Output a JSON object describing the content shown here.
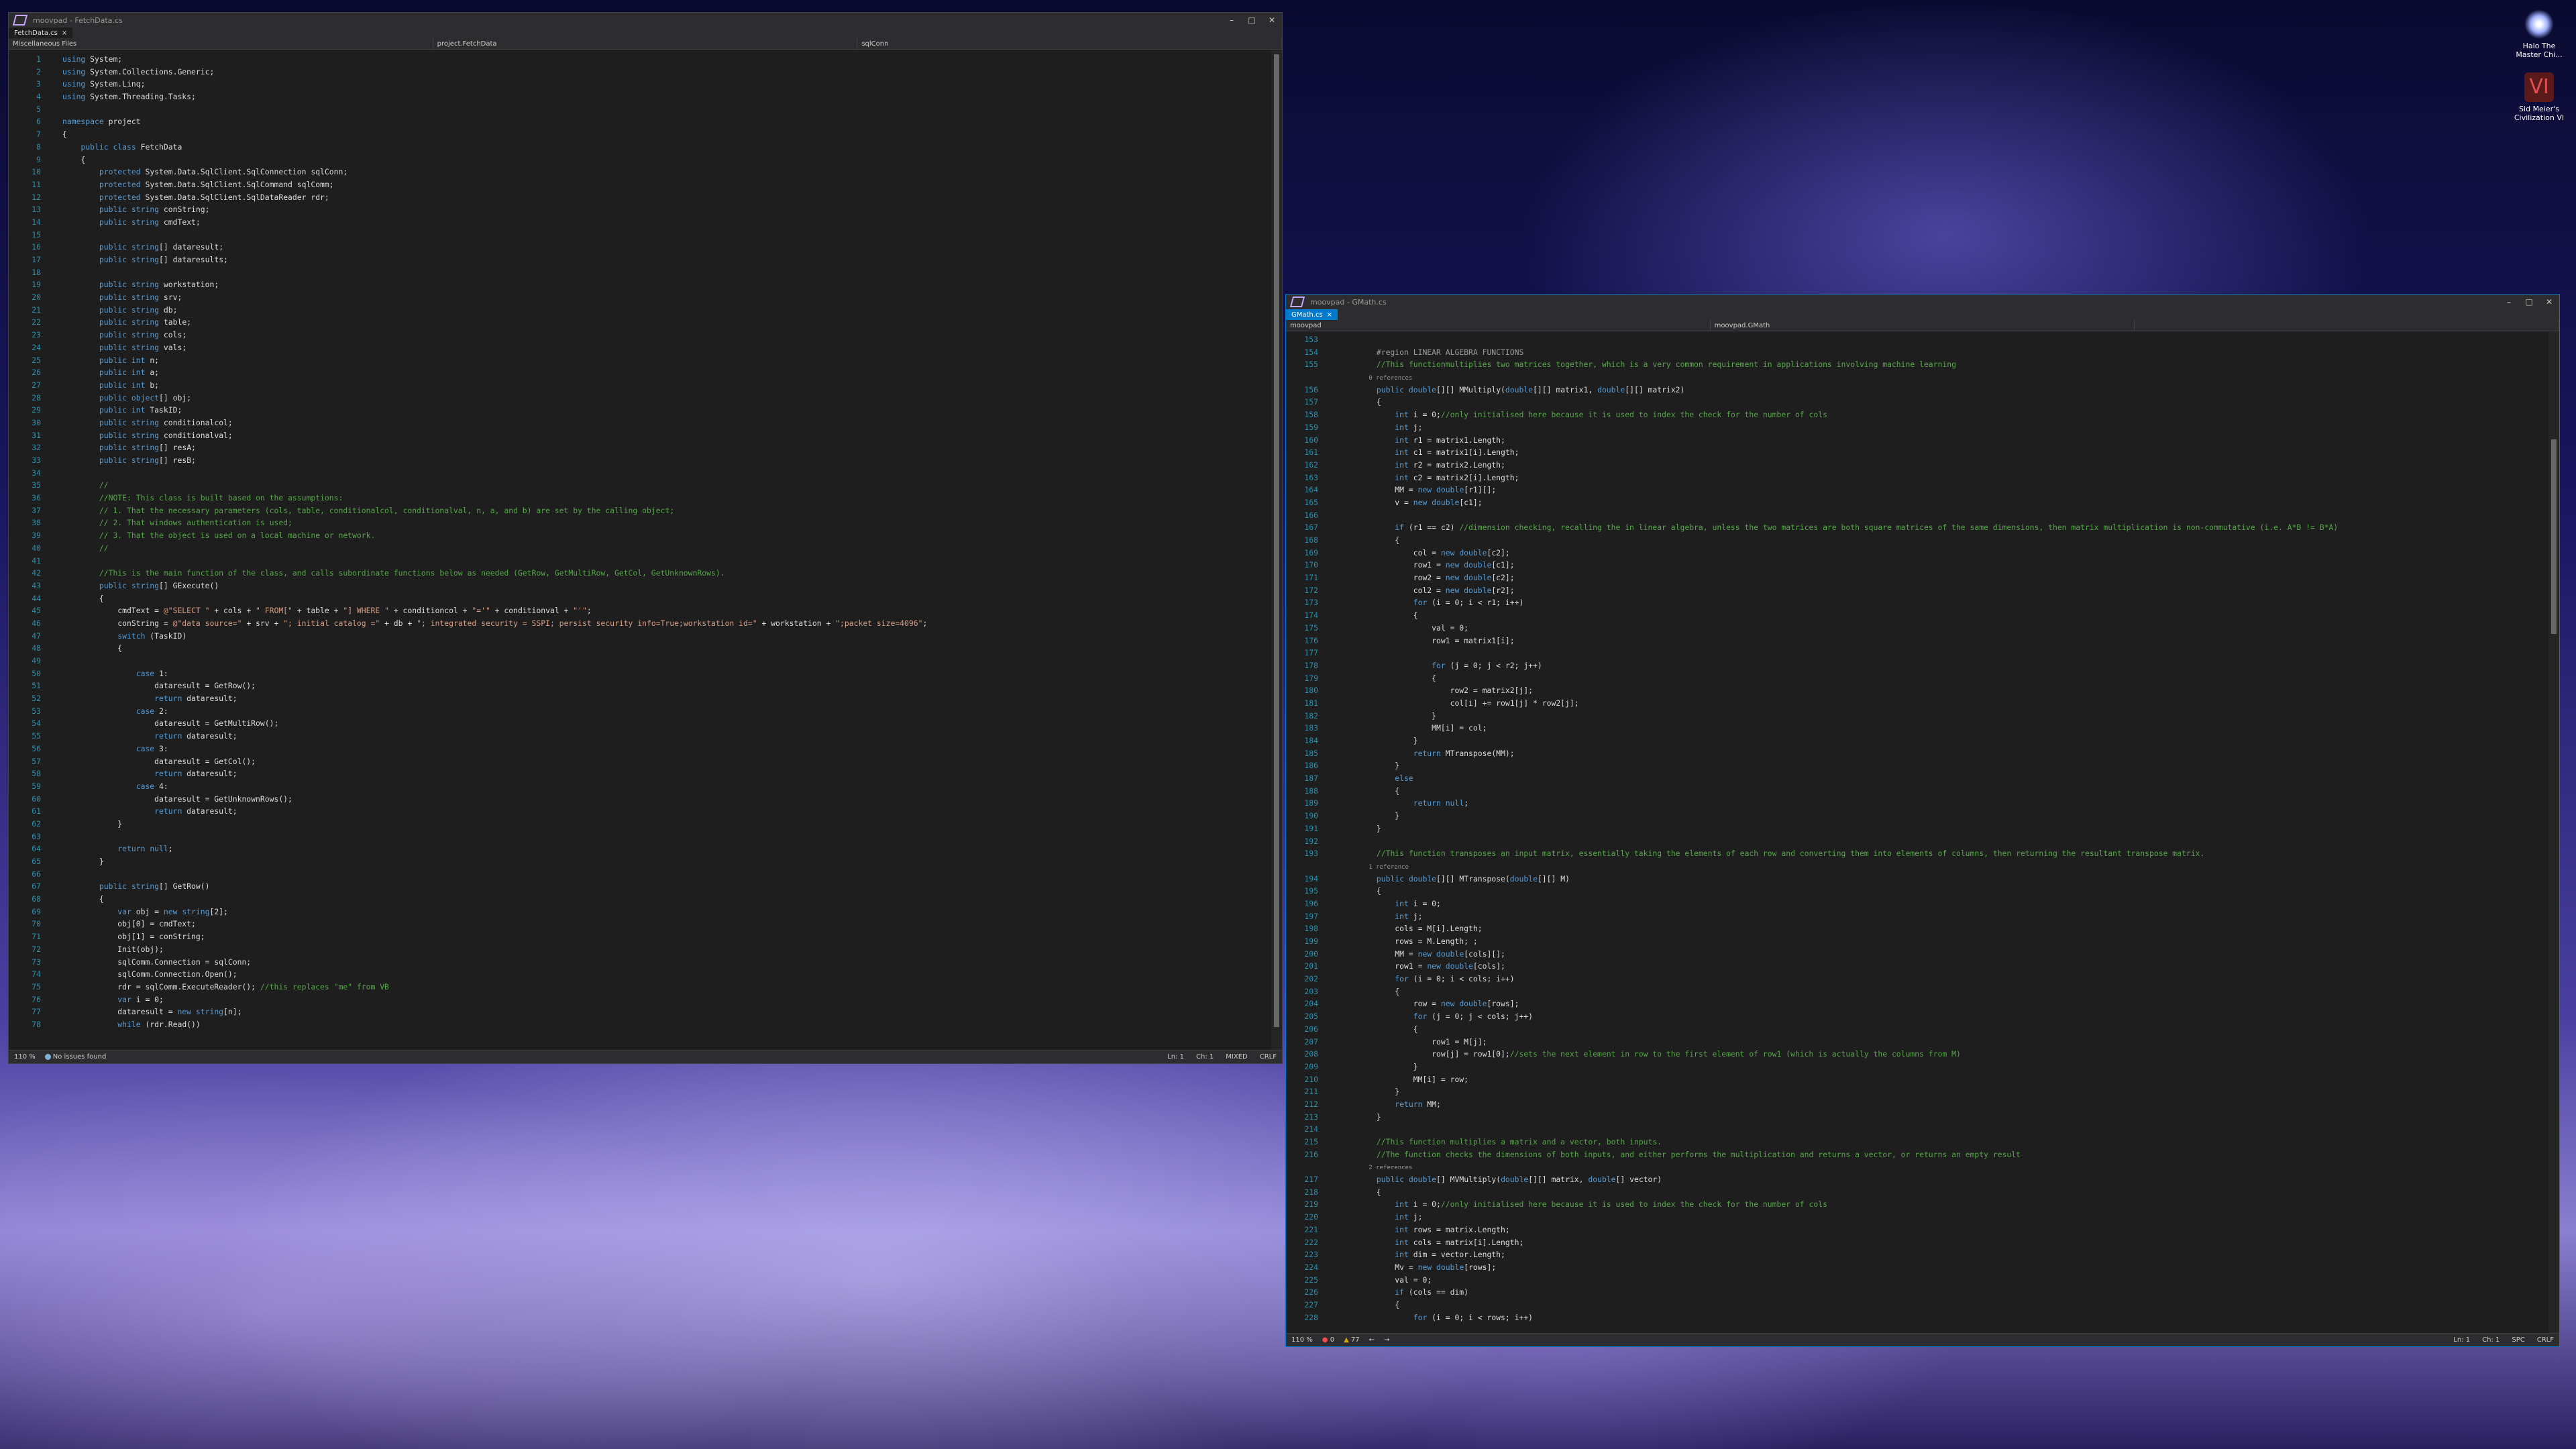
{
  "desktop": {
    "icons": [
      {
        "label": "Halo The Master Chi...",
        "color": "#c9d2ff"
      },
      {
        "label": "Sid Meier's Civilization VI",
        "color": "#b84040"
      }
    ]
  },
  "left_window": {
    "title": "moovpad - FetchData.cs",
    "tab": "FetchData.cs",
    "nav": [
      "Miscellaneous Files",
      "project.FetchData",
      "sqlConn"
    ],
    "zoom": "110 %",
    "issues": "No issues found",
    "status": {
      "ln": "Ln: 1",
      "ch": "Ch: 1",
      "mixed": "MIXED",
      "crlf": "CRLF"
    },
    "lines": [
      {
        "n": "1",
        "t": "using System;"
      },
      {
        "n": "2",
        "t": "using System.Collections.Generic;"
      },
      {
        "n": "3",
        "t": "using System.Linq;"
      },
      {
        "n": "4",
        "t": "using System.Threading.Tasks;"
      },
      {
        "n": "5",
        "t": ""
      },
      {
        "n": "6",
        "t": "namespace project"
      },
      {
        "n": "7",
        "t": "{"
      },
      {
        "n": "8",
        "t": "    public class FetchData"
      },
      {
        "n": "9",
        "t": "    {"
      },
      {
        "n": "10",
        "t": "        protected System.Data.SqlClient.SqlConnection sqlConn;"
      },
      {
        "n": "11",
        "t": "        protected System.Data.SqlClient.SqlCommand sqlComm;"
      },
      {
        "n": "12",
        "t": "        protected System.Data.SqlClient.SqlDataReader rdr;"
      },
      {
        "n": "13",
        "t": "        public string conString;"
      },
      {
        "n": "14",
        "t": "        public string cmdText;"
      },
      {
        "n": "15",
        "t": ""
      },
      {
        "n": "16",
        "t": "        public string[] dataresult;"
      },
      {
        "n": "17",
        "t": "        public string[] dataresults;"
      },
      {
        "n": "18",
        "t": ""
      },
      {
        "n": "19",
        "t": "        public string workstation;"
      },
      {
        "n": "20",
        "t": "        public string srv;"
      },
      {
        "n": "21",
        "t": "        public string db;"
      },
      {
        "n": "22",
        "t": "        public string table;"
      },
      {
        "n": "23",
        "t": "        public string cols;"
      },
      {
        "n": "24",
        "t": "        public string vals;"
      },
      {
        "n": "25",
        "t": "        public int n;"
      },
      {
        "n": "26",
        "t": "        public int a;"
      },
      {
        "n": "27",
        "t": "        public int b;"
      },
      {
        "n": "28",
        "t": "        public object[] obj;"
      },
      {
        "n": "29",
        "t": "        public int TaskID;"
      },
      {
        "n": "30",
        "t": "        public string conditionalcol;"
      },
      {
        "n": "31",
        "t": "        public string conditionalval;"
      },
      {
        "n": "32",
        "t": "        public string[] resA;"
      },
      {
        "n": "33",
        "t": "        public string[] resB;"
      },
      {
        "n": "34",
        "t": ""
      },
      {
        "n": "35",
        "t": "        //"
      },
      {
        "n": "36",
        "t": "        //NOTE: This class is built based on the assumptions:"
      },
      {
        "n": "37",
        "t": "        // 1. That the necessary parameters (cols, table, conditionalcol, conditionalval, n, a, and b) are set by the calling object;"
      },
      {
        "n": "38",
        "t": "        // 2. That windows authentication is used;"
      },
      {
        "n": "39",
        "t": "        // 3. That the object is used on a local machine or network."
      },
      {
        "n": "40",
        "t": "        //"
      },
      {
        "n": "41",
        "t": ""
      },
      {
        "n": "42",
        "t": "        //This is the main function of the class, and calls subordinate functions below as needed (GetRow, GetMultiRow, GetCol, GetUnknownRows)."
      },
      {
        "n": "43",
        "t": "        public string[] GExecute()"
      },
      {
        "n": "44",
        "t": "        {"
      },
      {
        "n": "45",
        "t": "            cmdText = @\"SELECT \" + cols + \" FROM[\" + table + \"] WHERE \" + conditioncol + \"='\" + conditionval + \"'\";"
      },
      {
        "n": "46",
        "t": "            conString = @\"data source=\" + srv + \"; initial catalog =\" + db + \"; integrated security = SSPI; persist security info=True;workstation id=\" + workstation + \";packet size=4096\";"
      },
      {
        "n": "47",
        "t": "            switch (TaskID)"
      },
      {
        "n": "48",
        "t": "            {"
      },
      {
        "n": "49",
        "t": ""
      },
      {
        "n": "50",
        "t": "                case 1:"
      },
      {
        "n": "51",
        "t": "                    dataresult = GetRow();"
      },
      {
        "n": "52",
        "t": "                    return dataresult;"
      },
      {
        "n": "53",
        "t": "                case 2:"
      },
      {
        "n": "54",
        "t": "                    dataresult = GetMultiRow();"
      },
      {
        "n": "55",
        "t": "                    return dataresult;"
      },
      {
        "n": "56",
        "t": "                case 3:"
      },
      {
        "n": "57",
        "t": "                    dataresult = GetCol();"
      },
      {
        "n": "58",
        "t": "                    return dataresult;"
      },
      {
        "n": "59",
        "t": "                case 4:"
      },
      {
        "n": "60",
        "t": "                    dataresult = GetUnknownRows();"
      },
      {
        "n": "61",
        "t": "                    return dataresult;"
      },
      {
        "n": "62",
        "t": "            }"
      },
      {
        "n": "63",
        "t": ""
      },
      {
        "n": "64",
        "t": "            return null;"
      },
      {
        "n": "65",
        "t": "        }"
      },
      {
        "n": "66",
        "t": ""
      },
      {
        "n": "67",
        "t": "        public string[] GetRow()"
      },
      {
        "n": "68",
        "t": "        {"
      },
      {
        "n": "69",
        "t": "            var obj = new string[2];"
      },
      {
        "n": "70",
        "t": "            obj[0] = cmdText;"
      },
      {
        "n": "71",
        "t": "            obj[1] = conString;"
      },
      {
        "n": "72",
        "t": "            Init(obj);"
      },
      {
        "n": "73",
        "t": "            sqlComm.Connection = sqlConn;"
      },
      {
        "n": "74",
        "t": "            sqlComm.Connection.Open();"
      },
      {
        "n": "75",
        "t": "            rdr = sqlComm.ExecuteReader(); //this replaces \"me\" from VB"
      },
      {
        "n": "76",
        "t": "            var i = 0;"
      },
      {
        "n": "77",
        "t": "            dataresult = new string[n];"
      },
      {
        "n": "78",
        "t": "            while (rdr.Read())"
      }
    ]
  },
  "right_window": {
    "title": "moovpad - GMath.cs",
    "tab": "GMath.cs",
    "nav": [
      "moovpad",
      "moovpad.GMath",
      ""
    ],
    "zoom": "110 %",
    "errors": "0",
    "warnings": "77",
    "status": {
      "ln": "Ln: 1",
      "ch": "Ch: 1",
      "spc": "SPC",
      "crlf": "CRLF"
    },
    "lines": [
      {
        "n": "153",
        "t": ""
      },
      {
        "n": "154",
        "t": "        #region LINEAR ALGEBRA FUNCTIONS"
      },
      {
        "n": "155",
        "t": "        //This functionmultiplies two matrices together, which is a very common requirement in applications involving machine learning"
      },
      {
        "n": "",
        "t": "        0 references"
      },
      {
        "n": "156",
        "t": "        public double[][] MMultiply(double[][] matrix1, double[][] matrix2)"
      },
      {
        "n": "157",
        "t": "        {"
      },
      {
        "n": "158",
        "t": "            int i = 0;//only initialised here because it is used to index the check for the number of cols"
      },
      {
        "n": "159",
        "t": "            int j;"
      },
      {
        "n": "160",
        "t": "            int r1 = matrix1.Length;"
      },
      {
        "n": "161",
        "t": "            int c1 = matrix1[i].Length;"
      },
      {
        "n": "162",
        "t": "            int r2 = matrix2.Length;"
      },
      {
        "n": "163",
        "t": "            int c2 = matrix2[i].Length;"
      },
      {
        "n": "164",
        "t": "            MM = new double[r1][];"
      },
      {
        "n": "165",
        "t": "            v = new double[c1];"
      },
      {
        "n": "166",
        "t": ""
      },
      {
        "n": "167",
        "t": "            if (r1 == c2) //dimension checking, recalling the in linear algebra, unless the two matrices are both square matrices of the same dimensions, then matrix multiplication is non-commutative (i.e. A*B != B*A)"
      },
      {
        "n": "168",
        "t": "            {"
      },
      {
        "n": "169",
        "t": "                col = new double[c2];"
      },
      {
        "n": "170",
        "t": "                row1 = new double[c1];"
      },
      {
        "n": "171",
        "t": "                row2 = new double[c2];"
      },
      {
        "n": "172",
        "t": "                col2 = new double[r2];"
      },
      {
        "n": "173",
        "t": "                for (i = 0; i < r1; i++)"
      },
      {
        "n": "174",
        "t": "                {"
      },
      {
        "n": "175",
        "t": "                    val = 0;"
      },
      {
        "n": "176",
        "t": "                    row1 = matrix1[i];"
      },
      {
        "n": "177",
        "t": ""
      },
      {
        "n": "178",
        "t": "                    for (j = 0; j < r2; j++)"
      },
      {
        "n": "179",
        "t": "                    {"
      },
      {
        "n": "180",
        "t": "                        row2 = matrix2[j];"
      },
      {
        "n": "181",
        "t": "                        col[i] += row1[j] * row2[j];"
      },
      {
        "n": "182",
        "t": "                    }"
      },
      {
        "n": "183",
        "t": "                    MM[i] = col;"
      },
      {
        "n": "184",
        "t": "                }"
      },
      {
        "n": "185",
        "t": "                return MTranspose(MM);"
      },
      {
        "n": "186",
        "t": "            }"
      },
      {
        "n": "187",
        "t": "            else"
      },
      {
        "n": "188",
        "t": "            {"
      },
      {
        "n": "189",
        "t": "                return null;"
      },
      {
        "n": "190",
        "t": "            }"
      },
      {
        "n": "191",
        "t": "        }"
      },
      {
        "n": "192",
        "t": ""
      },
      {
        "n": "193",
        "t": "        //This function transposes an input matrix, essentially taking the elements of each row and converting them into elements of columns, then returning the resultant transpose matrix."
      },
      {
        "n": "",
        "t": "        1 reference"
      },
      {
        "n": "194",
        "t": "        public double[][] MTranspose(double[][] M)"
      },
      {
        "n": "195",
        "t": "        {"
      },
      {
        "n": "196",
        "t": "            int i = 0;"
      },
      {
        "n": "197",
        "t": "            int j;"
      },
      {
        "n": "198",
        "t": "            cols = M[i].Length;"
      },
      {
        "n": "199",
        "t": "            rows = M.Length; ;"
      },
      {
        "n": "200",
        "t": "            MM = new double[cols][];"
      },
      {
        "n": "201",
        "t": "            row1 = new double[cols];"
      },
      {
        "n": "202",
        "t": "            for (i = 0; i < cols; i++)"
      },
      {
        "n": "203",
        "t": "            {"
      },
      {
        "n": "204",
        "t": "                row = new double[rows];"
      },
      {
        "n": "205",
        "t": "                for (j = 0; j < cols; j++)"
      },
      {
        "n": "206",
        "t": "                {"
      },
      {
        "n": "207",
        "t": "                    row1 = M[j];"
      },
      {
        "n": "208",
        "t": "                    row[j] = row1[0];//sets the next element in row to the first element of row1 (which is actually the columns from M)"
      },
      {
        "n": "209",
        "t": "                }"
      },
      {
        "n": "210",
        "t": "                MM[i] = row;"
      },
      {
        "n": "211",
        "t": "            }"
      },
      {
        "n": "212",
        "t": "            return MM;"
      },
      {
        "n": "213",
        "t": "        }"
      },
      {
        "n": "214",
        "t": ""
      },
      {
        "n": "215",
        "t": "        //This function multiplies a matrix and a vector, both inputs."
      },
      {
        "n": "216",
        "t": "        //The function checks the dimensions of both inputs, and either performs the multiplication and returns a vector, or returns an empty result"
      },
      {
        "n": "",
        "t": "        2 references"
      },
      {
        "n": "217",
        "t": "        public double[] MVMultiply(double[][] matrix, double[] vector)"
      },
      {
        "n": "218",
        "t": "        {"
      },
      {
        "n": "219",
        "t": "            int i = 0;//only initialised here because it is used to index the check for the number of cols"
      },
      {
        "n": "220",
        "t": "            int j;"
      },
      {
        "n": "221",
        "t": "            int rows = matrix.Length;"
      },
      {
        "n": "222",
        "t": "            int cols = matrix[i].Length;"
      },
      {
        "n": "223",
        "t": "            int dim = vector.Length;"
      },
      {
        "n": "224",
        "t": "            Mv = new double[rows];"
      },
      {
        "n": "225",
        "t": "            val = 0;"
      },
      {
        "n": "226",
        "t": "            if (cols == dim)"
      },
      {
        "n": "227",
        "t": "            {"
      },
      {
        "n": "228",
        "t": "                for (i = 0; i < rows; i++)"
      }
    ]
  }
}
